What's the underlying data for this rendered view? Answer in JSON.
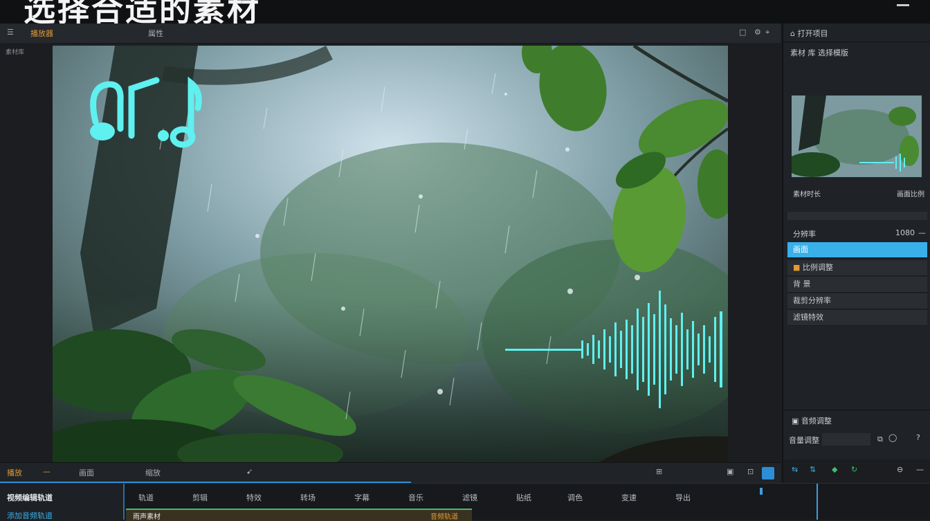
{
  "banner": {
    "title": "选择合适的素材"
  },
  "toolbar": {
    "items": [
      "播放器",
      "属性"
    ],
    "left_col_label": "素材库"
  },
  "preview_bar": {
    "items": [
      "播放",
      "画面",
      "缩放"
    ]
  },
  "right_panel": {
    "header": "打开项目",
    "sub_header": "素材 库 选择模版",
    "thumb_left": "素材时长",
    "thumb_right": "画面比例",
    "section_label": "分辨率",
    "section_value": "1080",
    "rows": [
      "画面",
      "比例调整",
      "背 景",
      "裁剪分辨率",
      "滤镜特效"
    ],
    "lower_header": "音频调整",
    "lower_field": "音量调整"
  },
  "timeline": {
    "side_title": "视频编辑轨道",
    "side_sub": "添加音频轨道",
    "cells": [
      "轨道",
      "剪辑",
      "特效",
      "转场",
      "字幕",
      "音乐",
      "滤镜",
      "贴纸",
      "调色",
      "变速",
      "导出"
    ],
    "clip_label": "雨声素材",
    "clip_right": "音频轨道"
  },
  "colors": {
    "accent": "#39b0ea",
    "orange": "#e39a34",
    "waveform": "#5ff0f0"
  }
}
